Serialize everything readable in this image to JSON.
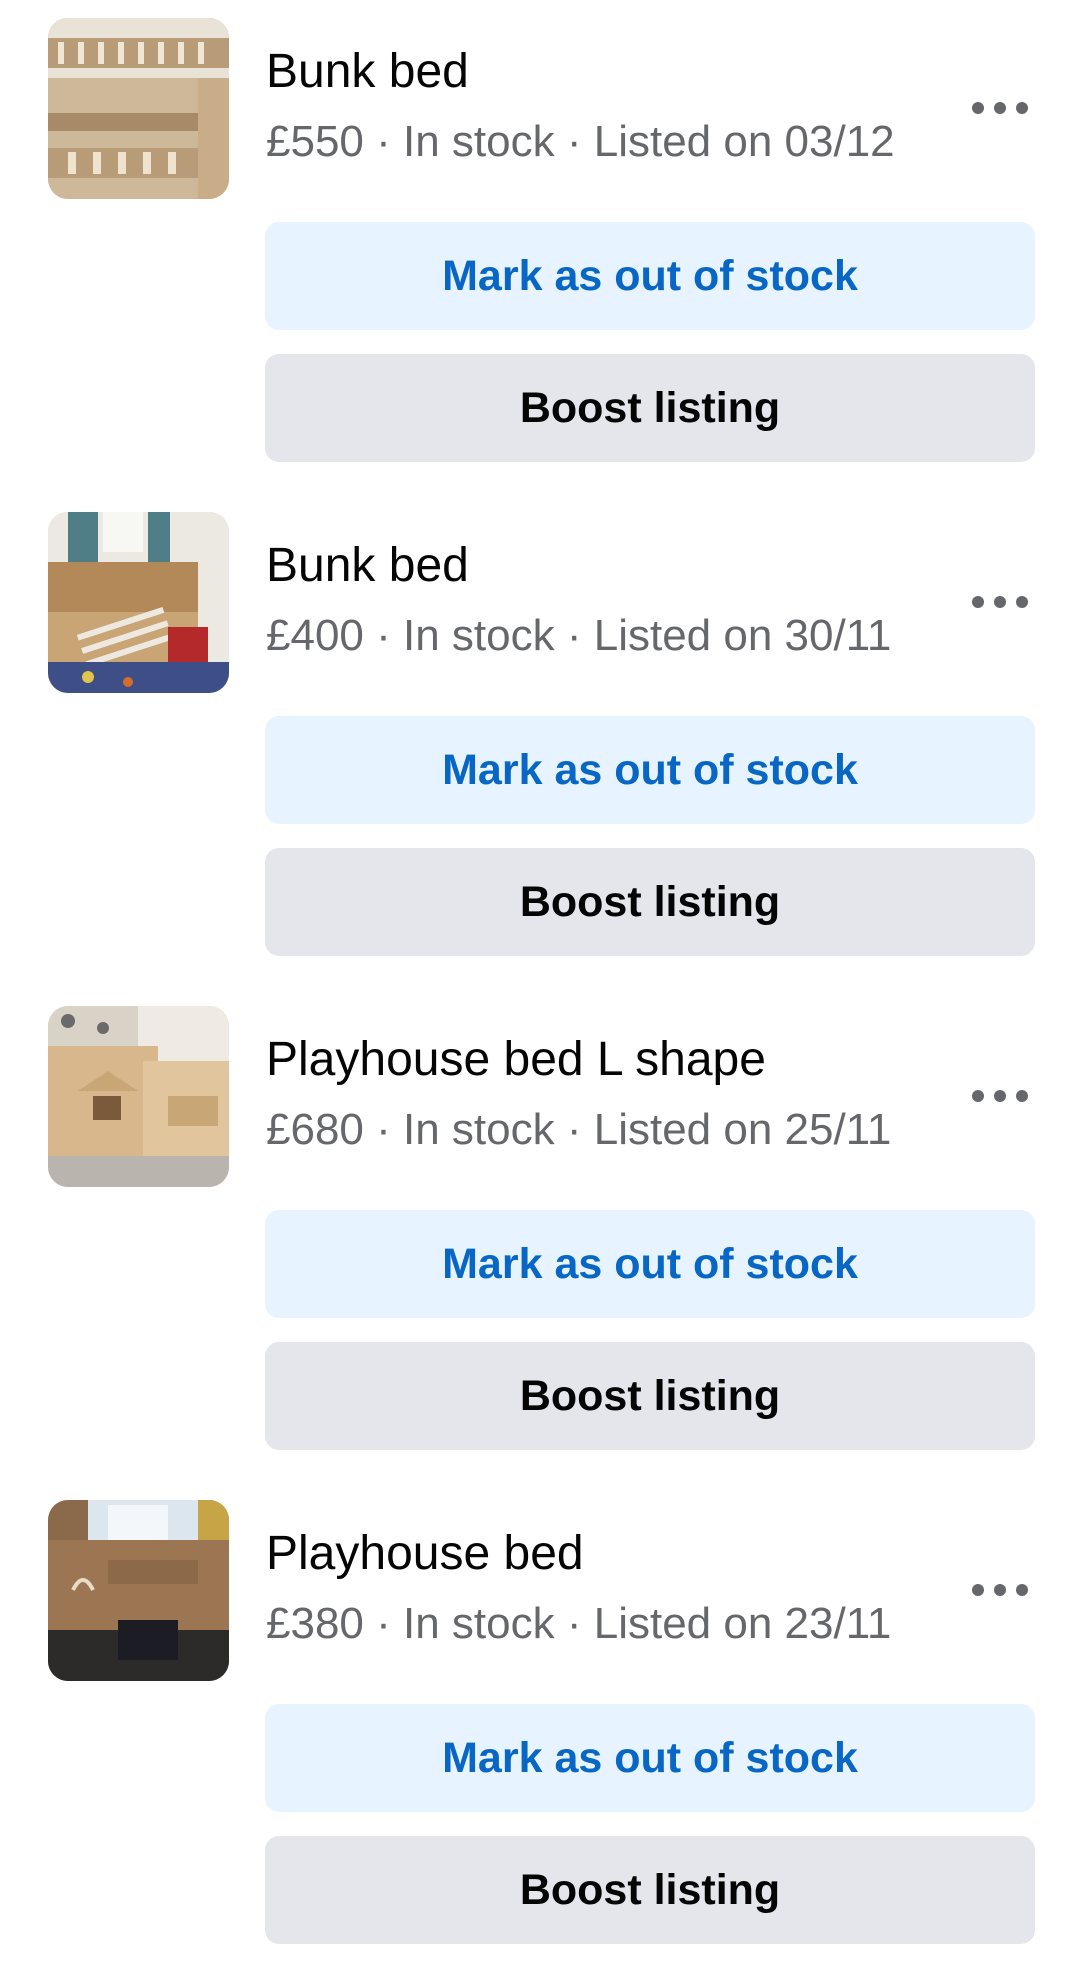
{
  "listings": [
    {
      "title": "Bunk bed",
      "price": "£550",
      "stock": "In stock",
      "listed": "Listed on 03/12",
      "mark_label": "Mark as out of stock",
      "boost_label": "Boost listing",
      "thumb_icon": "bunk-bed-photo"
    },
    {
      "title": "Bunk bed",
      "price": "£400",
      "stock": "In stock",
      "listed": "Listed on 30/11",
      "mark_label": "Mark as out of stock",
      "boost_label": "Boost listing",
      "thumb_icon": "bunk-bed-photo"
    },
    {
      "title": "Playhouse bed L shape",
      "price": "£680",
      "stock": "In stock",
      "listed": "Listed on 25/11",
      "mark_label": "Mark as out of stock",
      "boost_label": "Boost listing",
      "thumb_icon": "playhouse-bed-photo"
    },
    {
      "title": "Playhouse bed",
      "price": "£380",
      "stock": "In stock",
      "listed": "Listed on 23/11",
      "mark_label": "Mark as out of stock",
      "boost_label": "Boost listing",
      "thumb_icon": "playhouse-bed-photo"
    }
  ],
  "separator": " · ",
  "colors": {
    "primary_text": "#050505",
    "secondary_text": "#65676b",
    "accent_text": "#0866c4",
    "accent_button_bg": "#e7f3ff",
    "neutral_button_bg": "#e4e6eb"
  }
}
